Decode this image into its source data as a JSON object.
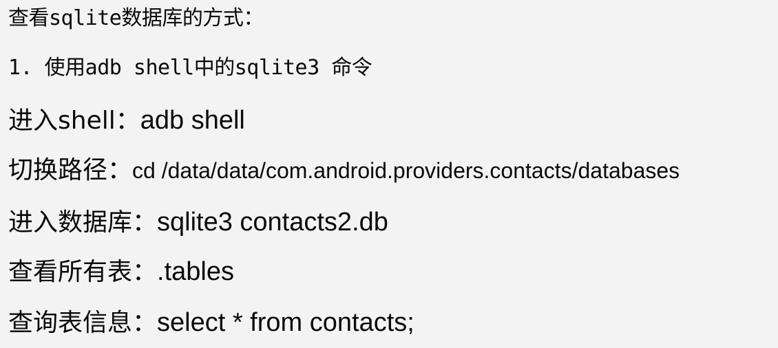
{
  "document": {
    "heading": "查看sqlite数据库的方式：",
    "subheading": "1. 使用adb shell中的sqlite3 命令",
    "steps": [
      {
        "label": "进入shell：",
        "command": "adb shell"
      },
      {
        "label": "切换路径：",
        "command": "cd /data/data/com.android.providers.contacts/databases"
      },
      {
        "label": "进入数据库：",
        "command": "sqlite3 contacts2.db"
      },
      {
        "label": "查看所有表：",
        "command": ".tables"
      },
      {
        "label": "查询表信息：",
        "command": "select * from contacts;"
      }
    ]
  }
}
